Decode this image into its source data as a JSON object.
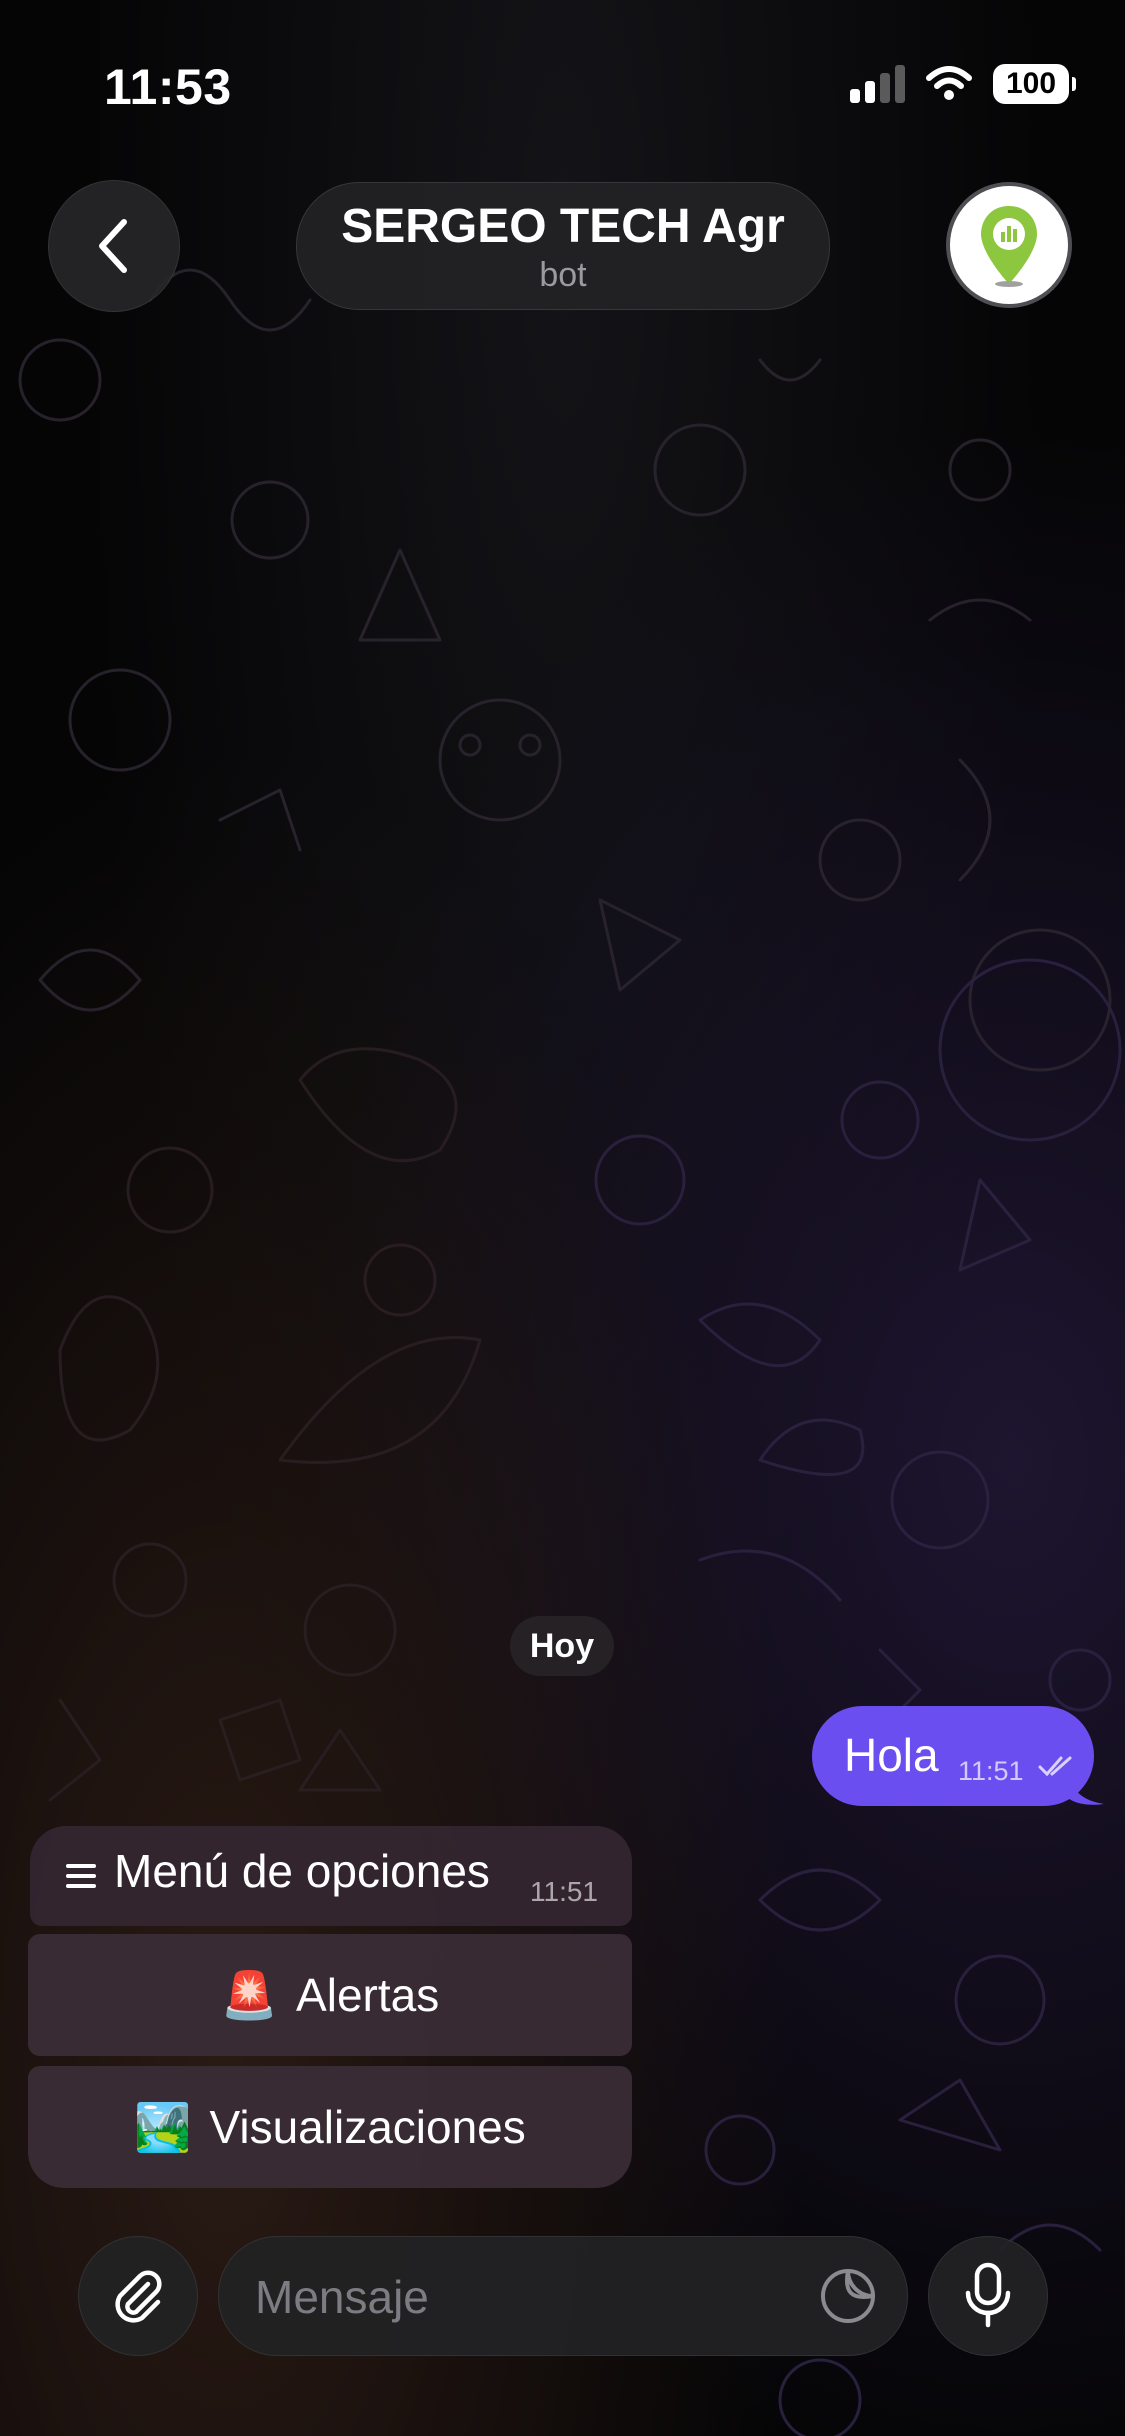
{
  "status_bar": {
    "time": "11:53",
    "battery": "100",
    "icons": [
      "cellular-signal-icon",
      "wifi-icon",
      "battery-icon"
    ]
  },
  "header": {
    "title": "SERGEO TECH Agr",
    "subtitle": "bot",
    "back_icon": "chevron-left-icon",
    "avatar_icon": "map-pin-logo"
  },
  "chat": {
    "date_label": "Hoy",
    "messages": [
      {
        "direction": "outgoing",
        "text": "Hola",
        "time": "11:51",
        "status_icon": "double-check-icon"
      },
      {
        "direction": "incoming",
        "text": "Menú de opciones",
        "time": "11:51",
        "icon": "menu-lines-icon"
      }
    ],
    "keyboard_buttons": [
      {
        "emoji": "🚨",
        "label": "Alertas"
      },
      {
        "emoji": "🏞️",
        "label": "Visualizaciones"
      }
    ]
  },
  "input_bar": {
    "placeholder": "Mensaje",
    "attach_icon": "paperclip-icon",
    "sticker_icon": "sticker-icon",
    "mic_icon": "microphone-icon"
  },
  "colors": {
    "background": "#050506",
    "outgoing_bubble": "#6b4ef0",
    "incoming_bubble": "#34263a",
    "avatar_pin": "#8dc63f"
  }
}
